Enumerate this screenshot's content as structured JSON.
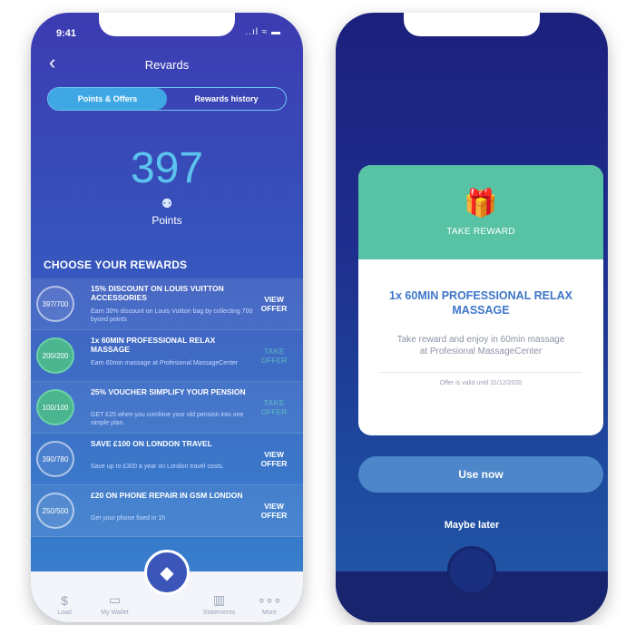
{
  "left_screen": {
    "status": {
      "time": "9:41",
      "icons": "..ıl ≈ ▬"
    },
    "header": {
      "back": "‹",
      "title": "Revards"
    },
    "tabs": [
      {
        "label": "Points & Offers",
        "active": true
      },
      {
        "label": "Rewards history",
        "active": false
      }
    ],
    "points": {
      "value": "397",
      "icon": "⚉",
      "label": "Points"
    },
    "section_title": "CHOOSE YOUR REWARDS",
    "rewards": [
      {
        "progress": "397/700",
        "complete": false,
        "title": "15% DISCOUNT ON LOUIS VUITTON ACCESSORIES",
        "description": "Earn 30% discount on Louis Vuitton bag by collecting 700 byond points",
        "action": "VIEW OFFER"
      },
      {
        "progress": "200/200",
        "complete": true,
        "title": "1x 60MIN PROFESSIONAL RELAX MASSAGE",
        "description": "Earn 60min massage at Profesional MassageCenter",
        "action": "TAKE OFFER"
      },
      {
        "progress": "100/100",
        "complete": true,
        "title": "25% VOUCHER SIMPLIFY YOUR PENSION",
        "description": "GET £25 when you combine your old pension into one simple plan.",
        "action": "TAKE OFFER"
      },
      {
        "progress": "390/780",
        "complete": false,
        "title": "SAVE £100 ON LONDON TRAVEL",
        "description": "Save up to £300 a year on London travel costs.",
        "action": "VIEW OFFER"
      },
      {
        "progress": "250/500",
        "complete": false,
        "title": "£20 ON PHONE REPAIR IN GSM LONDON",
        "description": "Get your phone fixed in 1h",
        "action": "VIEW OFFER"
      }
    ],
    "bottom_nav": [
      {
        "label": "Load",
        "icon": "$"
      },
      {
        "label": "My Wallet",
        "icon": "▭"
      },
      {
        "label": "Statements",
        "icon": "▥"
      },
      {
        "label": "More",
        "icon": "∘∘∘"
      }
    ],
    "fab_icon": "◆"
  },
  "right_screen": {
    "modal": {
      "icon": "🎁",
      "header_label": "TAKE REWARD",
      "title": "1x 60MIN PROFESSIONAL RELAX MASSAGE",
      "description": "Take reward and enjoy in 60min massage at Profesional MassageCenter",
      "valid": "Offer is valid until 31/12/2020"
    },
    "use_now": "Use now",
    "maybe_later": "Maybe later"
  }
}
